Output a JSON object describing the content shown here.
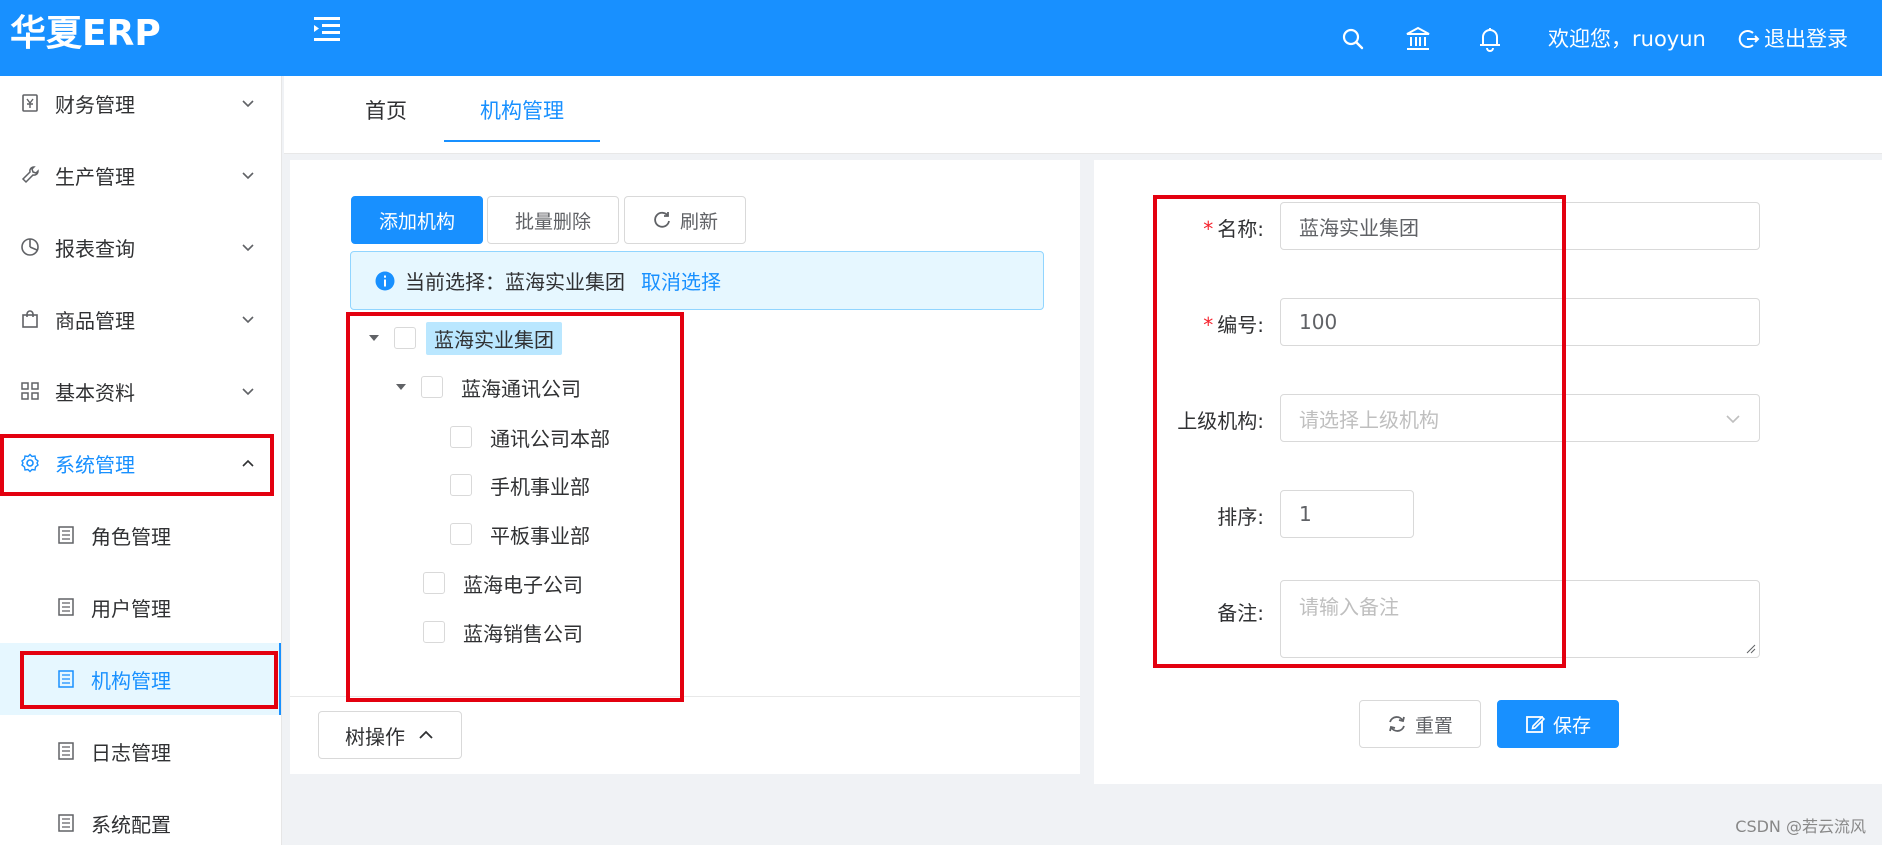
{
  "header": {
    "logo": "华夏ERP",
    "greeting": "欢迎您，ruoyun",
    "logout_label": "退出登录",
    "icons": [
      "menu-fold-icon",
      "search-icon",
      "bank-icon",
      "bell-icon",
      "logout-icon"
    ]
  },
  "sidebar": {
    "items": [
      {
        "label": "财务管理",
        "icon": "finance-icon",
        "expanded": false
      },
      {
        "label": "生产管理",
        "icon": "wrench-icon",
        "expanded": false
      },
      {
        "label": "报表查询",
        "icon": "pie-chart-icon",
        "expanded": false
      },
      {
        "label": "商品管理",
        "icon": "shopping-bag-icon",
        "expanded": false
      },
      {
        "label": "基本资料",
        "icon": "grid-icon",
        "expanded": false
      },
      {
        "label": "系统管理",
        "icon": "gear-icon",
        "expanded": true
      }
    ],
    "subitems": [
      {
        "label": "角色管理",
        "selected": false
      },
      {
        "label": "用户管理",
        "selected": false
      },
      {
        "label": "机构管理",
        "selected": true
      },
      {
        "label": "日志管理",
        "selected": false
      },
      {
        "label": "系统配置",
        "selected": false
      }
    ]
  },
  "tabs": [
    {
      "label": "首页",
      "active": false
    },
    {
      "label": "机构管理",
      "active": true
    }
  ],
  "toolbar": {
    "add_label": "添加机构",
    "batch_delete_label": "批量删除",
    "refresh_label": "刷新"
  },
  "alert": {
    "prefix": "当前选择：蓝海实业集团",
    "cancel_label": "取消选择"
  },
  "tree": {
    "nodes": [
      {
        "label": "蓝海实业集团",
        "level": 0,
        "expanded": true,
        "highlighted": true
      },
      {
        "label": "蓝海通讯公司",
        "level": 1,
        "expanded": true
      },
      {
        "label": "通讯公司本部",
        "level": 2
      },
      {
        "label": "手机事业部",
        "level": 2
      },
      {
        "label": "平板事业部",
        "level": 2
      },
      {
        "label": "蓝海电子公司",
        "level": 1
      },
      {
        "label": "蓝海销售公司",
        "level": 1
      }
    ],
    "ops_label": "树操作"
  },
  "form": {
    "name_label": "名称:",
    "name_value": "蓝海实业集团",
    "code_label": "编号:",
    "code_value": "100",
    "parent_label": "上级机构:",
    "parent_placeholder": "请选择上级机构",
    "sort_label": "排序:",
    "sort_value": "1",
    "remark_label": "备注:",
    "remark_placeholder": "请输入备注",
    "reset_label": "重置",
    "save_label": "保存"
  },
  "colors": {
    "primary": "#1890ff",
    "annotation_red": "#e3000f"
  },
  "watermark": "CSDN @若云流风"
}
